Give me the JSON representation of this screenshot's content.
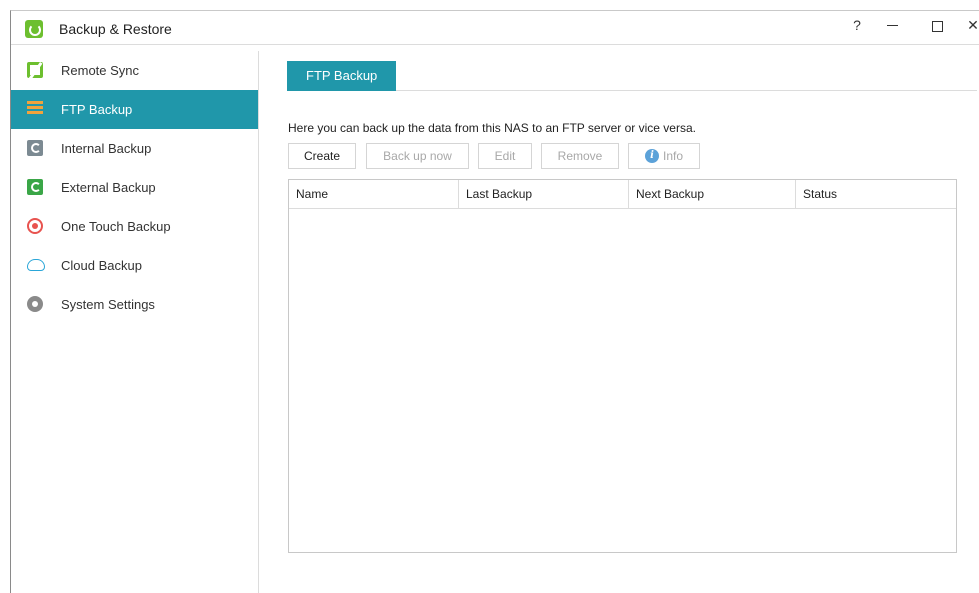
{
  "app": {
    "title": "Backup & Restore"
  },
  "titlebar": {
    "help_label": "?"
  },
  "sidebar": {
    "items": [
      {
        "label": "Remote Sync",
        "icon": "remote-sync-icon"
      },
      {
        "label": "FTP Backup",
        "icon": "ftp-backup-icon",
        "active": true
      },
      {
        "label": "Internal Backup",
        "icon": "internal-backup-icon"
      },
      {
        "label": "External Backup",
        "icon": "external-backup-icon"
      },
      {
        "label": "One Touch Backup",
        "icon": "one-touch-backup-icon"
      },
      {
        "label": "Cloud Backup",
        "icon": "cloud-icon"
      },
      {
        "label": "System Settings",
        "icon": "gear-icon"
      }
    ]
  },
  "main": {
    "tab": "FTP Backup",
    "description": "Here you can back up the data from this NAS to an FTP server or vice versa.",
    "toolbar": {
      "create": "Create",
      "backup_now": "Back up now",
      "edit": "Edit",
      "remove": "Remove",
      "info": "Info"
    },
    "table": {
      "columns": [
        "Name",
        "Last Backup",
        "Next Backup",
        "Status"
      ],
      "rows": []
    }
  },
  "colors": {
    "accent": "#2097aa",
    "brand_green": "#6dbf2f"
  }
}
